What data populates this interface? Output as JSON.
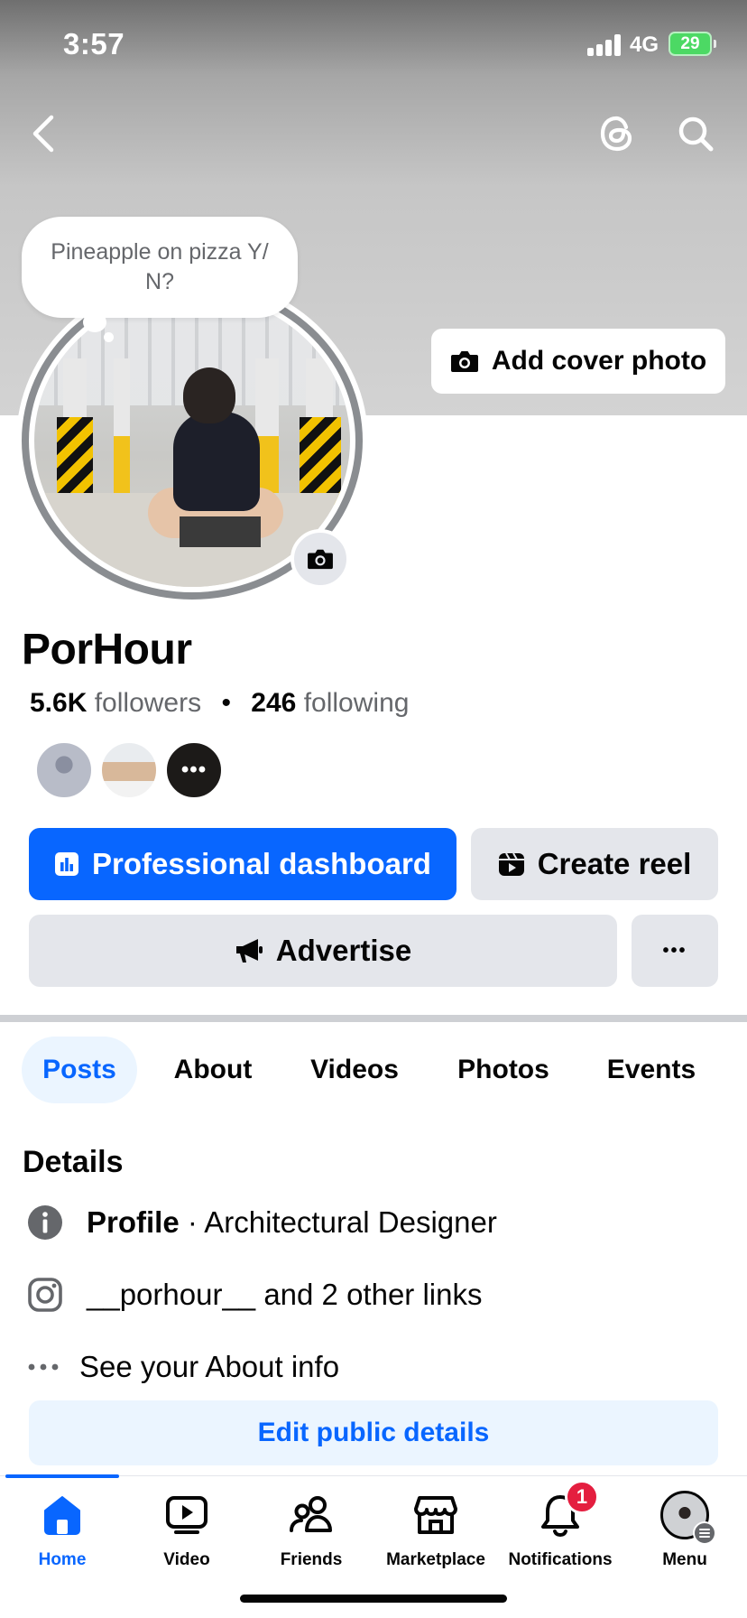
{
  "status_bar": {
    "time": "3:57",
    "network": "4G",
    "battery": "29"
  },
  "note": {
    "text": "Pineapple on pizza Y/ N?"
  },
  "cover": {
    "add_cover_label": "Add cover photo"
  },
  "profile": {
    "name": "PorHour",
    "followers_count": "5.6K",
    "followers_label": "followers",
    "separator": "•",
    "following_count": "246",
    "following_label": "following",
    "mutuals_more": "•••"
  },
  "actions": {
    "dashboard_label": "Professional dashboard",
    "create_reel_label": "Create reel",
    "advertise_label": "Advertise",
    "more_label": "•••"
  },
  "tabs": [
    {
      "label": "Posts",
      "active": true
    },
    {
      "label": "About"
    },
    {
      "label": "Videos"
    },
    {
      "label": "Photos"
    },
    {
      "label": "Events"
    }
  ],
  "details": {
    "title": "Details",
    "profile_label": "Profile",
    "profile_value": "· Architectural Designer",
    "links_text": "__porhour__ and 2 other links",
    "about_text": "See your About info",
    "edit_label": "Edit public details"
  },
  "bottom_nav": [
    {
      "label": "Home",
      "icon": "home-icon",
      "active": true
    },
    {
      "label": "Video",
      "icon": "video-icon"
    },
    {
      "label": "Friends",
      "icon": "friends-icon"
    },
    {
      "label": "Marketplace",
      "icon": "marketplace-icon"
    },
    {
      "label": "Notifications",
      "icon": "bell-icon",
      "badge": "1"
    },
    {
      "label": "Menu",
      "icon": "profile-avatar"
    }
  ],
  "colors": {
    "accent": "#0866ff",
    "badge": "#e41e3f",
    "battery": "#4cd964"
  }
}
